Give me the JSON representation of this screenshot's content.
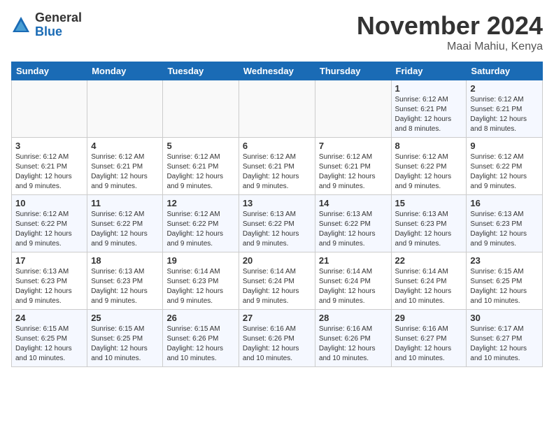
{
  "logo": {
    "general": "General",
    "blue": "Blue"
  },
  "title": {
    "month": "November 2024",
    "location": "Maai Mahiu, Kenya"
  },
  "headers": [
    "Sunday",
    "Monday",
    "Tuesday",
    "Wednesday",
    "Thursday",
    "Friday",
    "Saturday"
  ],
  "weeks": [
    [
      {
        "day": "",
        "info": ""
      },
      {
        "day": "",
        "info": ""
      },
      {
        "day": "",
        "info": ""
      },
      {
        "day": "",
        "info": ""
      },
      {
        "day": "",
        "info": ""
      },
      {
        "day": "1",
        "info": "Sunrise: 6:12 AM\nSunset: 6:21 PM\nDaylight: 12 hours\nand 8 minutes."
      },
      {
        "day": "2",
        "info": "Sunrise: 6:12 AM\nSunset: 6:21 PM\nDaylight: 12 hours\nand 8 minutes."
      }
    ],
    [
      {
        "day": "3",
        "info": "Sunrise: 6:12 AM\nSunset: 6:21 PM\nDaylight: 12 hours\nand 9 minutes."
      },
      {
        "day": "4",
        "info": "Sunrise: 6:12 AM\nSunset: 6:21 PM\nDaylight: 12 hours\nand 9 minutes."
      },
      {
        "day": "5",
        "info": "Sunrise: 6:12 AM\nSunset: 6:21 PM\nDaylight: 12 hours\nand 9 minutes."
      },
      {
        "day": "6",
        "info": "Sunrise: 6:12 AM\nSunset: 6:21 PM\nDaylight: 12 hours\nand 9 minutes."
      },
      {
        "day": "7",
        "info": "Sunrise: 6:12 AM\nSunset: 6:21 PM\nDaylight: 12 hours\nand 9 minutes."
      },
      {
        "day": "8",
        "info": "Sunrise: 6:12 AM\nSunset: 6:22 PM\nDaylight: 12 hours\nand 9 minutes."
      },
      {
        "day": "9",
        "info": "Sunrise: 6:12 AM\nSunset: 6:22 PM\nDaylight: 12 hours\nand 9 minutes."
      }
    ],
    [
      {
        "day": "10",
        "info": "Sunrise: 6:12 AM\nSunset: 6:22 PM\nDaylight: 12 hours\nand 9 minutes."
      },
      {
        "day": "11",
        "info": "Sunrise: 6:12 AM\nSunset: 6:22 PM\nDaylight: 12 hours\nand 9 minutes."
      },
      {
        "day": "12",
        "info": "Sunrise: 6:12 AM\nSunset: 6:22 PM\nDaylight: 12 hours\nand 9 minutes."
      },
      {
        "day": "13",
        "info": "Sunrise: 6:13 AM\nSunset: 6:22 PM\nDaylight: 12 hours\nand 9 minutes."
      },
      {
        "day": "14",
        "info": "Sunrise: 6:13 AM\nSunset: 6:22 PM\nDaylight: 12 hours\nand 9 minutes."
      },
      {
        "day": "15",
        "info": "Sunrise: 6:13 AM\nSunset: 6:23 PM\nDaylight: 12 hours\nand 9 minutes."
      },
      {
        "day": "16",
        "info": "Sunrise: 6:13 AM\nSunset: 6:23 PM\nDaylight: 12 hours\nand 9 minutes."
      }
    ],
    [
      {
        "day": "17",
        "info": "Sunrise: 6:13 AM\nSunset: 6:23 PM\nDaylight: 12 hours\nand 9 minutes."
      },
      {
        "day": "18",
        "info": "Sunrise: 6:13 AM\nSunset: 6:23 PM\nDaylight: 12 hours\nand 9 minutes."
      },
      {
        "day": "19",
        "info": "Sunrise: 6:14 AM\nSunset: 6:23 PM\nDaylight: 12 hours\nand 9 minutes."
      },
      {
        "day": "20",
        "info": "Sunrise: 6:14 AM\nSunset: 6:24 PM\nDaylight: 12 hours\nand 9 minutes."
      },
      {
        "day": "21",
        "info": "Sunrise: 6:14 AM\nSunset: 6:24 PM\nDaylight: 12 hours\nand 9 minutes."
      },
      {
        "day": "22",
        "info": "Sunrise: 6:14 AM\nSunset: 6:24 PM\nDaylight: 12 hours\nand 10 minutes."
      },
      {
        "day": "23",
        "info": "Sunrise: 6:15 AM\nSunset: 6:25 PM\nDaylight: 12 hours\nand 10 minutes."
      }
    ],
    [
      {
        "day": "24",
        "info": "Sunrise: 6:15 AM\nSunset: 6:25 PM\nDaylight: 12 hours\nand 10 minutes."
      },
      {
        "day": "25",
        "info": "Sunrise: 6:15 AM\nSunset: 6:25 PM\nDaylight: 12 hours\nand 10 minutes."
      },
      {
        "day": "26",
        "info": "Sunrise: 6:15 AM\nSunset: 6:26 PM\nDaylight: 12 hours\nand 10 minutes."
      },
      {
        "day": "27",
        "info": "Sunrise: 6:16 AM\nSunset: 6:26 PM\nDaylight: 12 hours\nand 10 minutes."
      },
      {
        "day": "28",
        "info": "Sunrise: 6:16 AM\nSunset: 6:26 PM\nDaylight: 12 hours\nand 10 minutes."
      },
      {
        "day": "29",
        "info": "Sunrise: 6:16 AM\nSunset: 6:27 PM\nDaylight: 12 hours\nand 10 minutes."
      },
      {
        "day": "30",
        "info": "Sunrise: 6:17 AM\nSunset: 6:27 PM\nDaylight: 12 hours\nand 10 minutes."
      }
    ]
  ]
}
